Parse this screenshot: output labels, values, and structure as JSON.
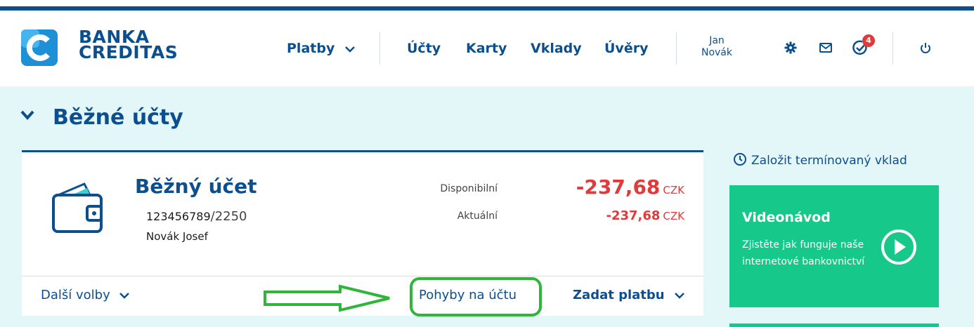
{
  "brand": {
    "line1": "BANKA",
    "line2": "CREDITAS"
  },
  "nav": {
    "payments": "Platby",
    "accounts": "Účty",
    "cards": "Karty",
    "deposits": "Vklady",
    "loans": "Úvěry"
  },
  "user": {
    "first": "Jan",
    "last": "Novák"
  },
  "notifications": {
    "count": "4"
  },
  "section": {
    "title": "Běžné účty"
  },
  "account": {
    "name": "Běžný účet",
    "number": "123456789",
    "bank_code": "/2250",
    "owner": "Novák Josef",
    "available_label": "Disponibilní",
    "available_amount": "-237,68",
    "current_label": "Aktuální",
    "current_amount": "-237,68",
    "currency": "CZK"
  },
  "actions": {
    "more": "Další volby",
    "movements": "Pohyby na účtu",
    "pay": "Zadat platbu"
  },
  "sidebar": {
    "deposit_link": "Založit termínovaný vklad",
    "video_title": "Videonávod",
    "video_text": "Zjistěte jak funguje naše internetové bankovnictví"
  },
  "colors": {
    "brand_blue": "#0b4f8f",
    "negative_red": "#e03a3a",
    "promo_green": "#16c98a",
    "highlight_green": "#2fb53a"
  }
}
